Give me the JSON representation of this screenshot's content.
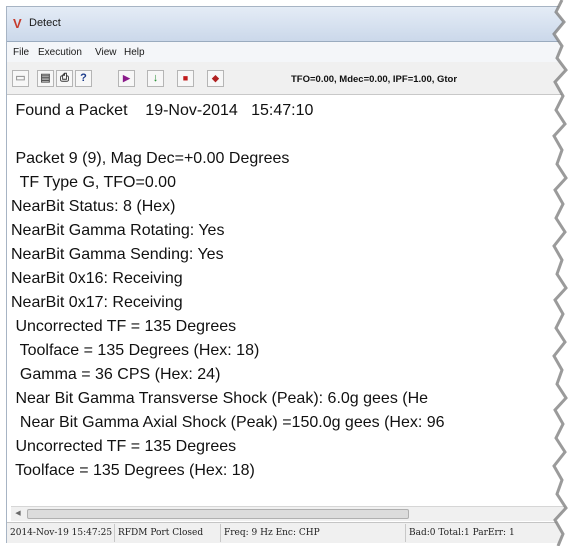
{
  "window": {
    "title": "Detect"
  },
  "menu": [
    "File",
    "Execution",
    "View",
    "Help"
  ],
  "toolbar": {
    "status_text": "TFO=0.00, Mdec=0.00, IPF=1.00, Gtor",
    "icons": [
      "blank-doc-icon",
      "open-folder-icon",
      "print-icon",
      "help-icon",
      "play-icon",
      "down-arrow-icon",
      "stop-icon",
      "record-icon"
    ]
  },
  "output_lines": [
    " Found a Packet    19-Nov-2014   15:47:10",
    "",
    " Packet 9 (9), Mag Dec=+0.00 Degrees",
    "  TF Type G, TFO=0.00",
    "NearBit Status: 8 (Hex)",
    "NearBit Gamma Rotating: Yes",
    "NearBit Gamma Sending: Yes",
    "NearBit 0x16: Receiving",
    "NearBit 0x17: Receiving",
    " Uncorrected TF = 135 Degrees",
    "  Toolface = 135 Degrees (Hex: 18)",
    "  Gamma = 36 CPS (Hex: 24)",
    " Near Bit Gamma Transverse Shock (Peak): 6.0g gees (He",
    "  Near Bit Gamma Axial Shock (Peak) =150.0g gees (Hex: 96",
    " Uncorrected TF = 135 Degrees",
    " Toolface = 135 Degrees (Hex: 18)"
  ],
  "status_bar": [
    "2014-Nov-19 15:47:25",
    "RFDM Port Closed",
    "Freq: 9 Hz Enc: CHP",
    "Bad:0 Total:1 ParErr: 1"
  ],
  "colors": {
    "titlebar": "#cbd8ea",
    "background": "#ffffff",
    "app_icon": "#c63b2c"
  }
}
